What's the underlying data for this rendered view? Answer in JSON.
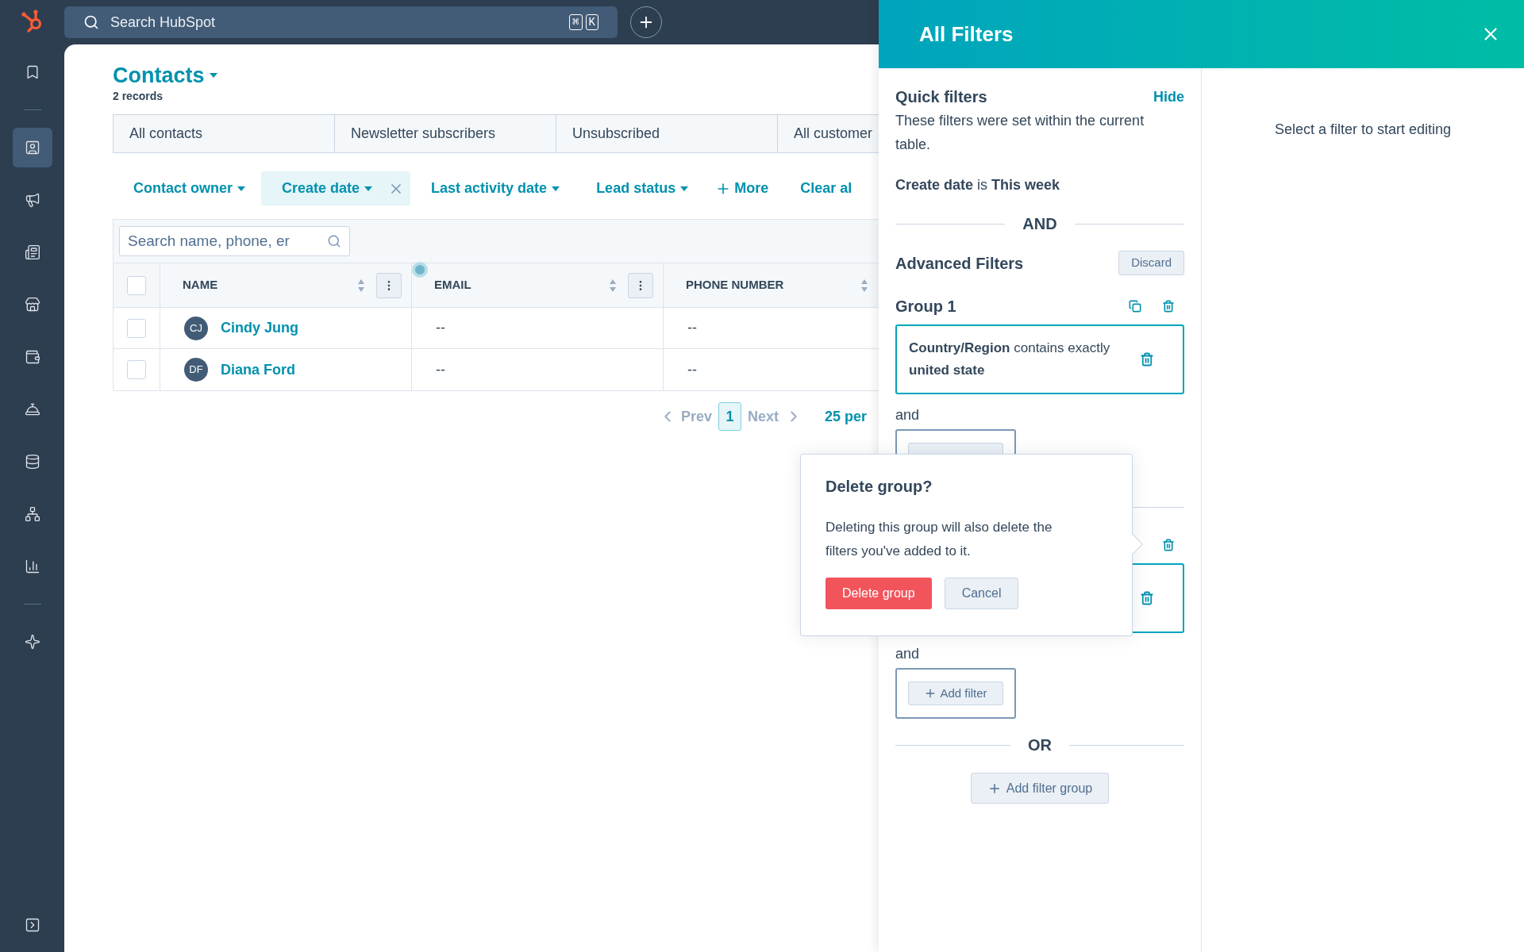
{
  "topbar": {
    "search_placeholder": "Search HubSpot",
    "shortcut_keys": [
      "⌘",
      "K"
    ]
  },
  "sidebar": {
    "items": [
      {
        "selected": false
      },
      {
        "selected": true
      },
      {
        "selected": false
      },
      {
        "selected": false
      },
      {
        "selected": false
      },
      {
        "selected": false
      },
      {
        "selected": false
      },
      {
        "selected": false
      },
      {
        "selected": false
      },
      {
        "selected": false
      },
      {
        "selected": false
      }
    ]
  },
  "contacts": {
    "title": "Contacts",
    "record_count": "2 records",
    "views": [
      {
        "label": "All contacts"
      },
      {
        "label": "Newsletter subscribers"
      },
      {
        "label": "Unsubscribed"
      },
      {
        "label": "All customer"
      }
    ],
    "filters": [
      {
        "label": "Contact owner",
        "active": false
      },
      {
        "label": "Create date",
        "active": true
      },
      {
        "label": "Last activity date",
        "active": false
      },
      {
        "label": "Lead status",
        "active": false
      }
    ],
    "more": "More",
    "clear": "Clear al"
  },
  "table": {
    "search_placeholder": "Search name, phone, er",
    "all_checked": false,
    "columns": [
      "NAME",
      "EMAIL",
      "PHONE NUMBER"
    ],
    "rows": [
      {
        "checked": false,
        "initials": "CJ",
        "name": "Cindy Jung",
        "email": "--",
        "phone": "--"
      },
      {
        "checked": false,
        "initials": "DF",
        "name": "Diana Ford",
        "email": "--",
        "phone": "--"
      }
    ]
  },
  "pagination": {
    "prev": "Prev",
    "page": "1",
    "next": "Next",
    "per_page": "25 per"
  },
  "panel": {
    "title": "All Filters",
    "quick_filters": {
      "heading": "Quick filters",
      "hide": "Hide",
      "description": "These filters were set within the current table.",
      "filter": "**Create date** is **This week**"
    },
    "and_label": "AND",
    "advanced": {
      "heading": "Advanced Filters",
      "discard": "Discard"
    },
    "groups": [
      {
        "title": "Group 1",
        "filters": [
          "**Country/Region** contains exactly **united state**"
        ],
        "joiner": "and"
      },
      {
        "joiner": "and",
        "add_filter": "Add filter"
      }
    ],
    "or_label": "OR",
    "add_group": "Add filter group",
    "editor_hint": "Select a filter to start editing"
  },
  "popover": {
    "title": "Delete group?",
    "body": "Deleting this group will also delete the filters you've added to it.",
    "confirm": "Delete group",
    "cancel": "Cancel"
  }
}
